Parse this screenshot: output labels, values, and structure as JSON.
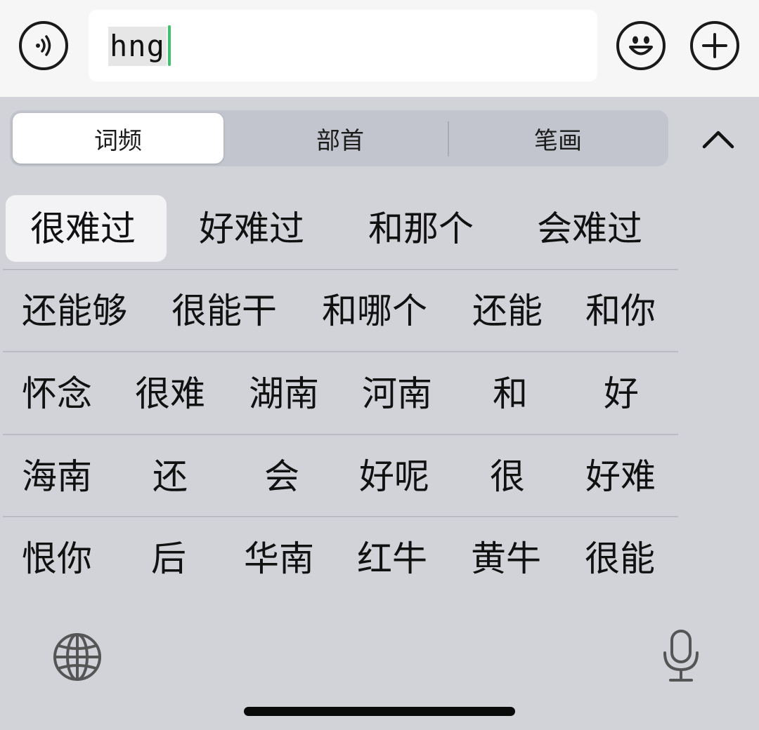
{
  "input": {
    "text": "hng"
  },
  "tabs": [
    {
      "label": "词频",
      "selected": true
    },
    {
      "label": "部首",
      "selected": false
    },
    {
      "label": "笔画",
      "selected": false
    }
  ],
  "icons": {
    "voice": "voice-message-icon",
    "emoji": "emoji-icon",
    "plus": "plus-icon",
    "collapse": "chevron-up-icon",
    "globe": "globe-icon",
    "mic": "microphone-icon"
  },
  "candidates": [
    [
      "很难过",
      "好难过",
      "和那个",
      "会难过"
    ],
    [
      "还能够",
      "很能干",
      "和哪个",
      "还能",
      "和你"
    ],
    [
      "怀念",
      "很难",
      "湖南",
      "河南",
      "和",
      "好"
    ],
    [
      "海南",
      "还",
      "会",
      "好呢",
      "很",
      "好难"
    ],
    [
      "恨你",
      "后",
      "华南",
      "红牛",
      "黄牛",
      "很能"
    ]
  ],
  "colors": {
    "cursor": "#3cc46a",
    "keyboard_bg": "#d1d3d9"
  }
}
